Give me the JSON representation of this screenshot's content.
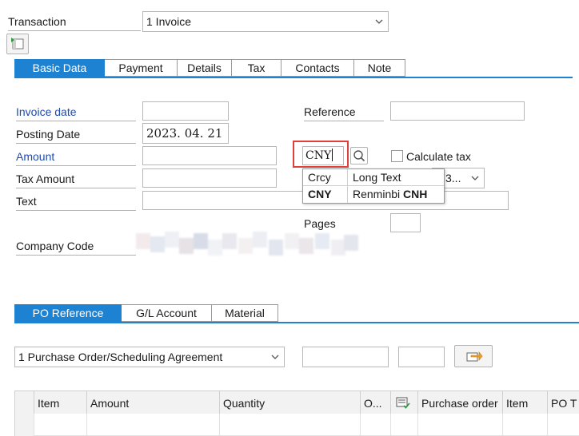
{
  "header": {
    "transaction_label": "Transaction",
    "transaction_value": "1 Invoice"
  },
  "tabs_main": [
    {
      "label": "Basic Data",
      "active": true
    },
    {
      "label": "Payment",
      "active": false
    },
    {
      "label": "Details",
      "active": false
    },
    {
      "label": "Tax",
      "active": false
    },
    {
      "label": "Contacts",
      "active": false
    },
    {
      "label": "Note",
      "active": false
    }
  ],
  "basic": {
    "invoice_date_label": "Invoice date",
    "invoice_date_value": "",
    "posting_date_label": "Posting Date",
    "posting_date_value": "2023. 04. 21",
    "amount_label": "Amount",
    "amount_value": "",
    "currency_value": "CNY",
    "calculate_tax_label": "Calculate tax",
    "calculate_tax_checked": false,
    "tax_amount_label": "Tax Amount",
    "tax_code_value": "3...",
    "text_label": "Text",
    "reference_label": "Reference",
    "reference_value": "",
    "pages_label": "Pages",
    "company_code_label": "Company Code"
  },
  "currency_popup": {
    "col1_header": "Crcy",
    "col2_header": "Long Text",
    "rows": [
      {
        "code": "CNY",
        "text_prefix": "Renminbi ",
        "text_bold": "CNH"
      }
    ]
  },
  "tabs_bottom": [
    {
      "label": "PO Reference",
      "active": true
    },
    {
      "label": "G/L Account",
      "active": false
    },
    {
      "label": "Material",
      "active": false
    }
  ],
  "po_ref": {
    "doc_type_value": "1 Purchase Order/Scheduling Agreement"
  },
  "table": {
    "columns": [
      "Item",
      "Amount",
      "Quantity",
      "O...",
      "",
      "Purchase order",
      "Item",
      "PO T"
    ]
  },
  "colors": {
    "accent": "#1e82d2",
    "label_blue": "#1f4ab0",
    "highlight_red": "#e0403a"
  },
  "icons": {
    "toolbar": "layout-toggle-icon",
    "search": "search-icon",
    "transfer": "transfer-icon",
    "table_settings": "table-settings-icon"
  }
}
